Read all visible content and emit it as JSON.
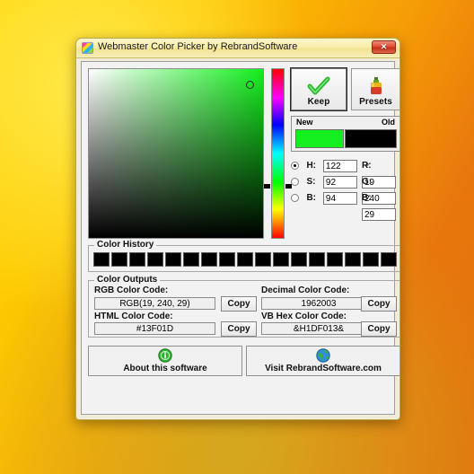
{
  "window": {
    "title": "Webmaster Color Picker by RebrandSoftware",
    "icon": "color-squares-icon",
    "close_label": "✕"
  },
  "picker": {
    "gradient_field_name": "saturation-brightness-field",
    "hue_strip_name": "hue-slider",
    "selected_hex": "#13F01D"
  },
  "actions": {
    "keep_label": "Keep",
    "keep_icon": "green-check-icon",
    "presets_label": "Presets",
    "presets_icon": "paint-bottle-icon"
  },
  "preview": {
    "new_label": "New",
    "old_label": "Old",
    "new_color": "#13F01D",
    "old_color": "#000000"
  },
  "hsb": {
    "rows": [
      {
        "label": "H:",
        "value": "122",
        "unit": "°",
        "selected": true
      },
      {
        "label": "S:",
        "value": "92",
        "unit": "%",
        "selected": false
      },
      {
        "label": "B:",
        "value": "94",
        "unit": "%",
        "selected": false
      }
    ]
  },
  "rgb": {
    "rows": [
      {
        "label": "R:",
        "value": "19"
      },
      {
        "label": "G:",
        "value": "240"
      },
      {
        "label": "B:",
        "value": "29"
      }
    ]
  },
  "history": {
    "title": "Color History",
    "swatches": [
      "#000000",
      "#000000",
      "#000000",
      "#000000",
      "#000000",
      "#000000",
      "#000000",
      "#000000",
      "#000000",
      "#000000",
      "#000000",
      "#000000",
      "#000000",
      "#000000",
      "#000000",
      "#000000",
      "#000000"
    ]
  },
  "outputs": {
    "title": "Color Outputs",
    "copy_label": "Copy",
    "fields": [
      {
        "label": "RGB Color Code:",
        "value": "RGB(19, 240, 29)"
      },
      {
        "label": "Decimal Color Code:",
        "value": "1962003"
      },
      {
        "label": "HTML Color Code:",
        "value": "#13F01D"
      },
      {
        "label": "VB Hex Color Code:",
        "value": "&H1DF013&"
      }
    ]
  },
  "footer": {
    "about_label": "About this software",
    "about_icon": "info-icon",
    "visit_label": "Visit RebrandSoftware.com",
    "visit_icon": "globe-icon"
  }
}
